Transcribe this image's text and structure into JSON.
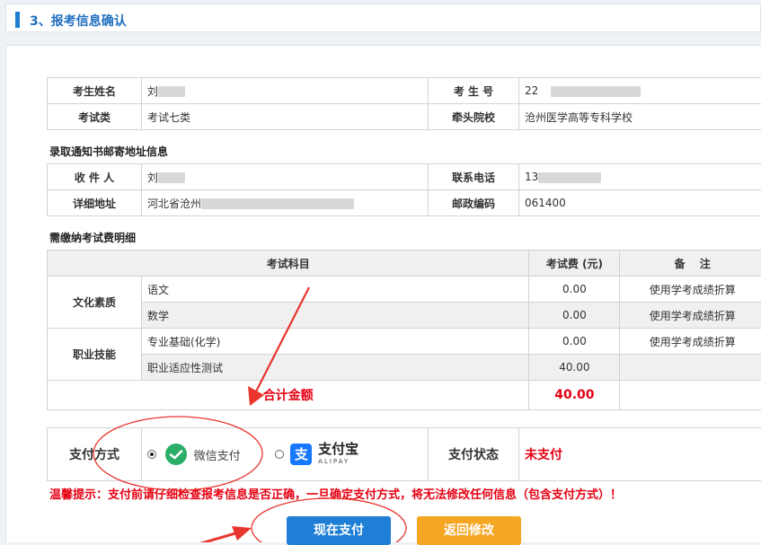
{
  "header": {
    "title": "3、报考信息确认"
  },
  "info": {
    "name_label": "考生姓名",
    "name_value": "刘",
    "exam_no_label": "考 生 号",
    "exam_no_value": "22",
    "exam_type_label": "考试类",
    "exam_type_value": "考试七类",
    "school_label": "牵头院校",
    "school_value": "沧州医学高等专科学校"
  },
  "mail": {
    "section_title": "录取通知书邮寄地址信息",
    "recipient_label": "收 件 人",
    "recipient_value": "刘",
    "phone_label": "联系电话",
    "phone_value": "13",
    "address_label": "详细地址",
    "address_value": "河北省沧州",
    "zip_label": "邮政编码",
    "zip_value": "061400"
  },
  "fees": {
    "section_title": "需缴纳考试费明细",
    "headers": {
      "subject": "考试科目",
      "fee": "考试费 (元)",
      "remark": "备　 注"
    },
    "groups": [
      {
        "name": "文化素质",
        "rows": [
          {
            "subject": "语文",
            "fee": "0.00",
            "remark": "使用学考成绩折算"
          },
          {
            "subject": "数学",
            "fee": "0.00",
            "remark": "使用学考成绩折算"
          }
        ]
      },
      {
        "name": "职业技能",
        "rows": [
          {
            "subject": "专业基础(化学)",
            "fee": "0.00",
            "remark": "使用学考成绩折算"
          },
          {
            "subject": "职业适应性测试",
            "fee": "40.00",
            "remark": ""
          }
        ]
      }
    ],
    "total_label": "合计金额",
    "total_value": "40.00"
  },
  "payment": {
    "method_label": "支付方式",
    "wechat_label": "微信支付",
    "alipay_label": "支付宝",
    "alipay_sub": "ALIPAY",
    "status_label": "支付状态",
    "status_value": "未支付"
  },
  "tip": "温馨提示：支付前请仔细检查报考信息是否正确，一旦确定支付方式，将无法修改任何信息（包含支付方式）！",
  "buttons": {
    "pay": "现在支付",
    "back": "返回修改"
  },
  "colors": {
    "accent": "#1f7fd6",
    "warning": "#e60012",
    "back_button": "#f5a623",
    "wechat": "#2aae67",
    "alipay": "#1677ff"
  }
}
